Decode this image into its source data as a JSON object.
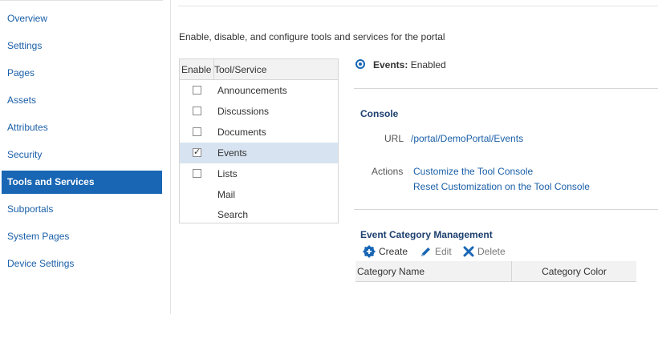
{
  "sidebar": {
    "items": [
      {
        "label": "Overview",
        "active": false
      },
      {
        "label": "Settings",
        "active": false
      },
      {
        "label": "Pages",
        "active": false
      },
      {
        "label": "Assets",
        "active": false
      },
      {
        "label": "Attributes",
        "active": false
      },
      {
        "label": "Security",
        "active": false
      },
      {
        "label": "Tools and Services",
        "active": true
      },
      {
        "label": "Subportals",
        "active": false
      },
      {
        "label": "System Pages",
        "active": false
      },
      {
        "label": "Device Settings",
        "active": false
      }
    ]
  },
  "main": {
    "description": "Enable, disable, and configure tools and services for the portal",
    "tool_table": {
      "headers": {
        "enable": "Enable",
        "tool": "Tool/Service"
      },
      "rows": [
        {
          "name": "Announcements",
          "checkbox": true,
          "checked": false,
          "selected": false
        },
        {
          "name": "Discussions",
          "checkbox": true,
          "checked": false,
          "selected": false
        },
        {
          "name": "Documents",
          "checkbox": true,
          "checked": false,
          "selected": false
        },
        {
          "name": "Events",
          "checkbox": true,
          "checked": true,
          "selected": true
        },
        {
          "name": "Lists",
          "checkbox": true,
          "checked": false,
          "selected": false
        },
        {
          "name": "Mail",
          "checkbox": false,
          "checked": false,
          "selected": false
        },
        {
          "name": "Search",
          "checkbox": false,
          "checked": false,
          "selected": false
        }
      ]
    }
  },
  "detail": {
    "tool_name": "Events:",
    "status": "Enabled",
    "console": {
      "title": "Console",
      "url_label": "URL",
      "url_value": "/portal/DemoPortal/Events",
      "actions_label": "Actions",
      "action1": "Customize the Tool Console",
      "action2": "Reset Customization on the Tool Console"
    },
    "category": {
      "title": "Event Category Management",
      "create": "Create",
      "edit": "Edit",
      "delete": "Delete",
      "col1": "Category Name",
      "col2": "Category Color"
    }
  },
  "colors": {
    "accent": "#1866b4",
    "link": "#1a5fa8",
    "selected_row": "#d7e3f1",
    "section_title": "#1c3f6e"
  }
}
